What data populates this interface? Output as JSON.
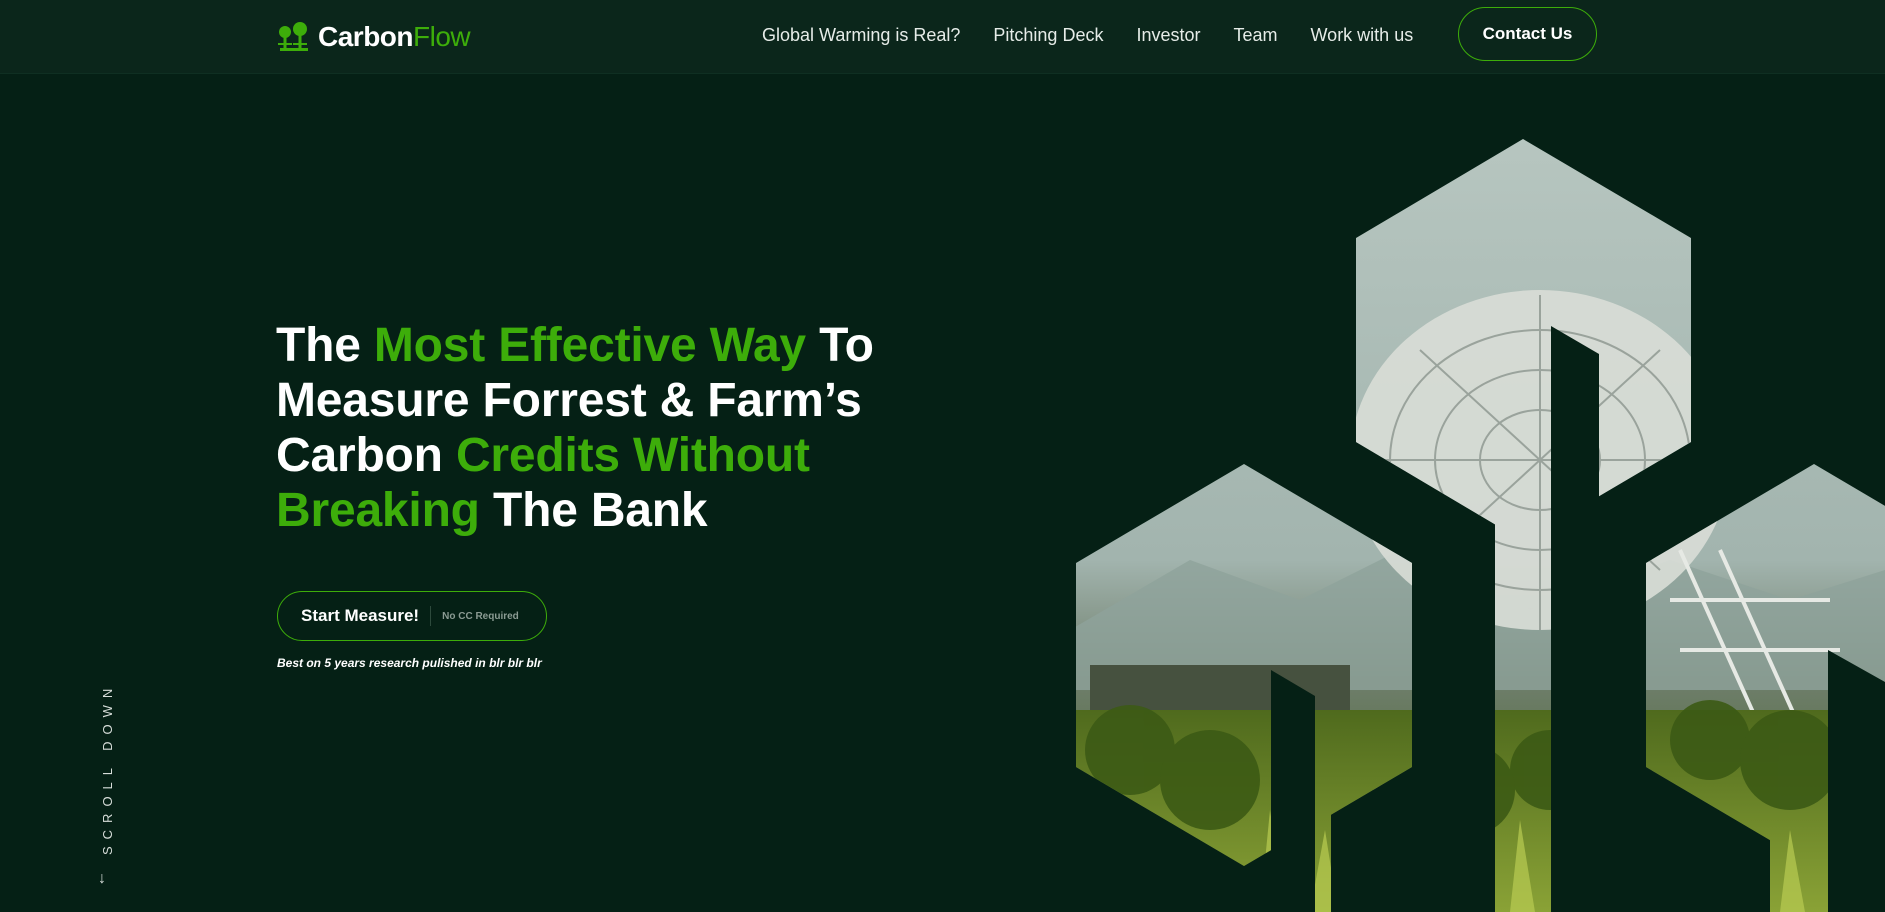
{
  "brand": {
    "name_primary": "Carbon",
    "name_accent": "Flow",
    "accent_color": "#3dad0a",
    "background_color": "#052015",
    "logo_icon": "tree-logo-icon"
  },
  "nav": {
    "items": [
      {
        "label": "Global Warming is Real?"
      },
      {
        "label": "Pitching Deck"
      },
      {
        "label": "Investor"
      },
      {
        "label": "Team"
      },
      {
        "label": "Work with us"
      }
    ],
    "contact_label": "Contact Us"
  },
  "hero": {
    "title": {
      "line1_a": "The ",
      "line1_b": "Most Effective Way",
      "line1_c": " To",
      "line2": "Measure Forrest & Farm’s",
      "line3_a": "Carbon ",
      "line3_b": "Credits Without",
      "line4_a": "Breaking",
      "line4_b": " The Bank"
    },
    "cta_label": "Start Measure!",
    "cta_note": "No CC Required",
    "research_note": "Best on 5 years research pulished in blr blr blr"
  },
  "scroll": {
    "label": "SCROLL DOWN",
    "icon": "arrow-down-icon"
  },
  "graphic": {
    "description_icon": "radio-telescope-hexagon-image"
  }
}
